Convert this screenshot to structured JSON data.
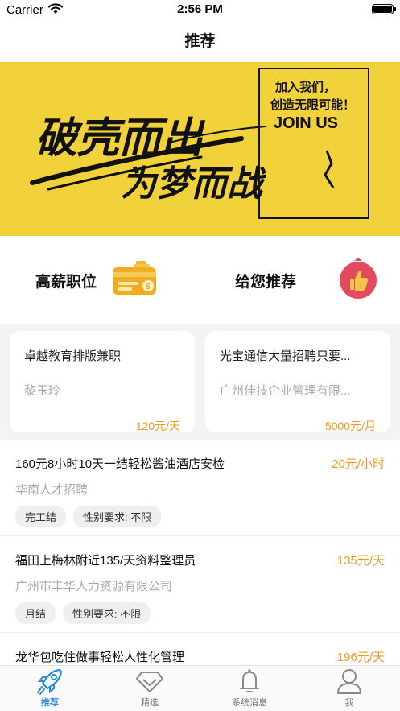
{
  "status_bar": {
    "carrier": "Carrier",
    "time": "2:56 PM"
  },
  "nav": {
    "title": "推荐"
  },
  "banner": {
    "headline_line1": "破壳而出",
    "headline_line2": "为梦而战",
    "box_line1": "加入我们，",
    "box_line2": "创造无限可能！",
    "box_line3": "JOIN US",
    "background_color": "#f2d23a"
  },
  "quick_links": [
    {
      "label": "高薪职位",
      "icon": "card-money-icon"
    },
    {
      "label": "给您推荐",
      "icon": "thumbs-up-icon"
    }
  ],
  "featured_jobs": [
    {
      "title": "卓越教育排版兼职",
      "company": "黎玉玲",
      "salary": "120元/天"
    },
    {
      "title": "光宝通信大量招聘只要...",
      "company": "广州佳技企业管理有限...",
      "salary": "5000元/月"
    }
  ],
  "jobs": [
    {
      "title": "160元8小时10天一结轻松酱油酒店安检",
      "salary": "20元/小时",
      "company": "华南人才招聘",
      "tags": [
        "完工结",
        "性别要求: 不限"
      ]
    },
    {
      "title": "福田上梅林附近135/天资料整理员",
      "salary": "135元/天",
      "company": "广州市丰华人力资源有限公司",
      "tags": [
        "月结",
        "性别要求: 不限"
      ]
    },
    {
      "title": "龙华包吃住做事轻松人性化管理",
      "salary": "196元/天",
      "company": "",
      "tags": []
    }
  ],
  "tabs": [
    {
      "label": "推荐",
      "icon": "rocket-icon",
      "active": true
    },
    {
      "label": "精选",
      "icon": "diamond-icon",
      "active": false
    },
    {
      "label": "系统消息",
      "icon": "bell-icon",
      "active": false
    },
    {
      "label": "我",
      "icon": "user-icon",
      "active": false
    }
  ],
  "colors": {
    "accent": "#2a8ad8",
    "salary": "#f19a1f",
    "muted": "#a9a9a9"
  }
}
